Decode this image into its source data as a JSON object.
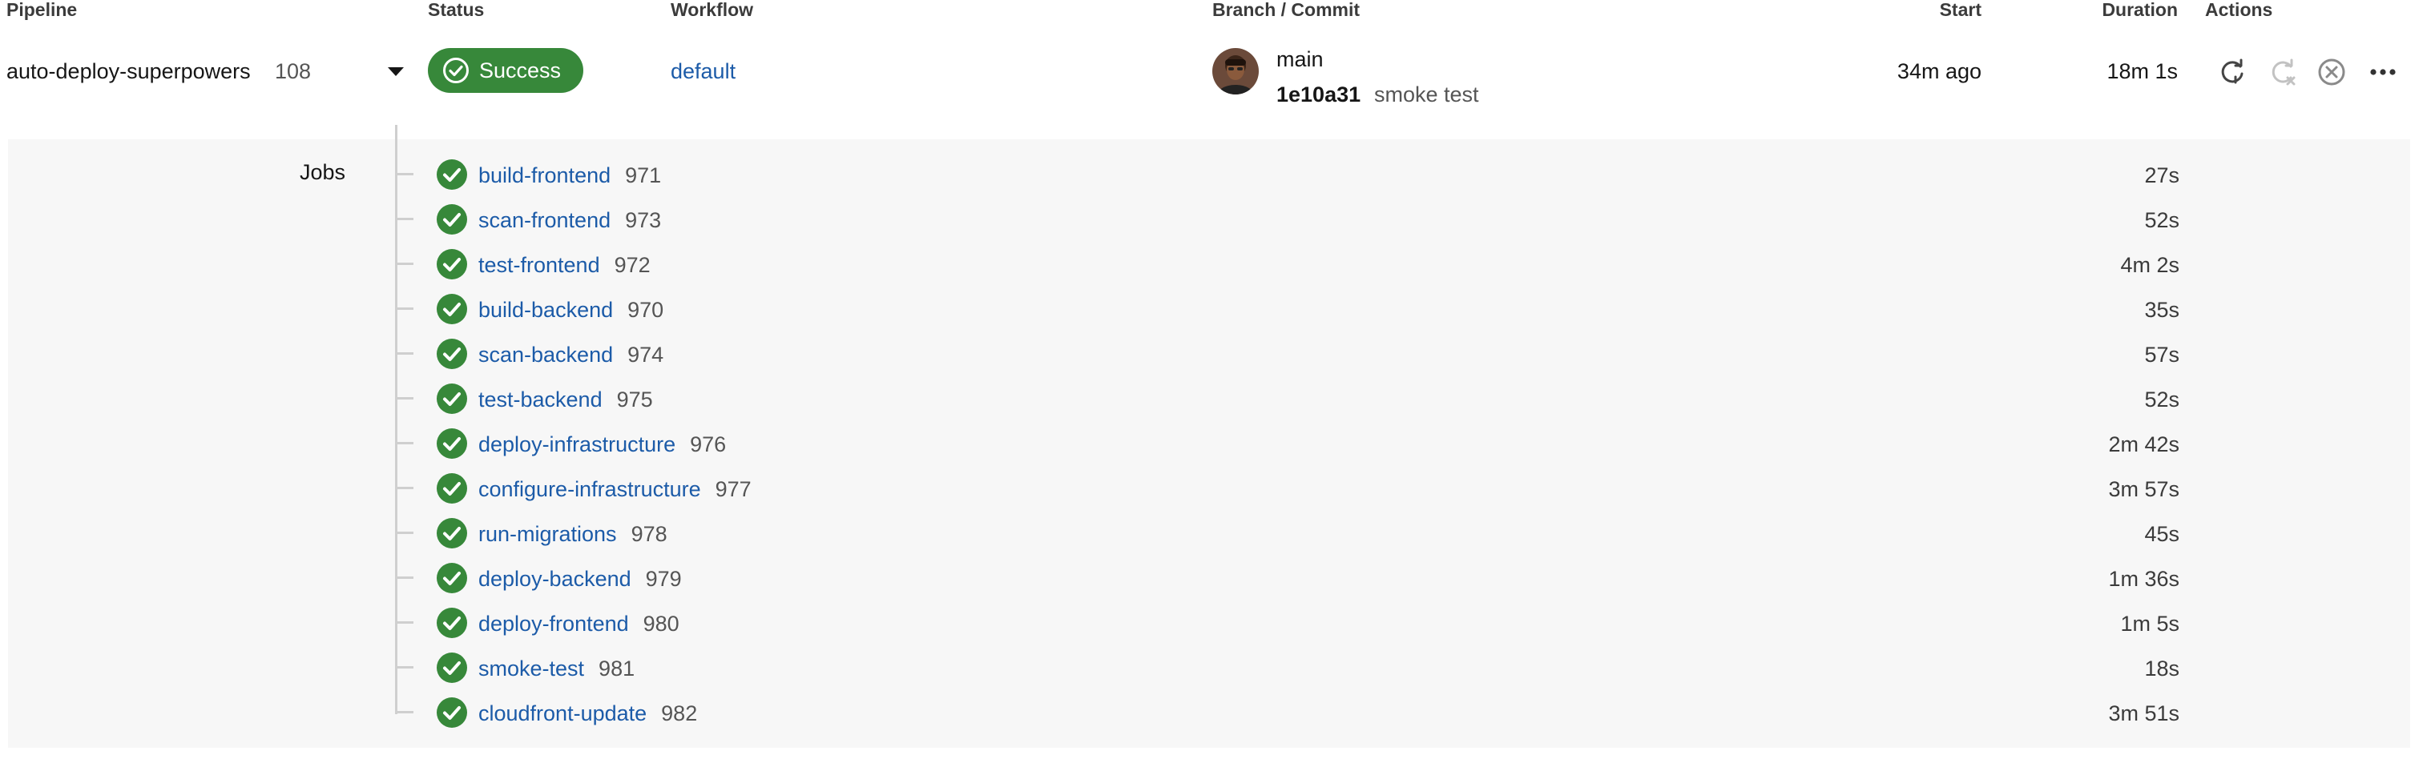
{
  "header": {
    "pipeline": "Pipeline",
    "status": "Status",
    "workflow": "Workflow",
    "branch_commit": "Branch / Commit",
    "start": "Start",
    "duration": "Duration",
    "actions": "Actions"
  },
  "pipeline": {
    "name": "auto-deploy-superpowers",
    "number": "108",
    "status": "Success",
    "workflow": "default",
    "branch": "main",
    "commit_hash": "1e10a31",
    "commit_message": "smoke test",
    "start": "34m ago",
    "duration": "18m 1s"
  },
  "actions": {
    "icons": [
      "rerun-icon",
      "rerun-failed-disabled-icon",
      "cancel-icon",
      "more-icon"
    ]
  },
  "jobs": {
    "label": "Jobs",
    "items": [
      {
        "name": "build-frontend",
        "number": "971",
        "duration": "27s"
      },
      {
        "name": "scan-frontend",
        "number": "973",
        "duration": "52s"
      },
      {
        "name": "test-frontend",
        "number": "972",
        "duration": "4m 2s"
      },
      {
        "name": "build-backend",
        "number": "970",
        "duration": "35s"
      },
      {
        "name": "scan-backend",
        "number": "974",
        "duration": "57s"
      },
      {
        "name": "test-backend",
        "number": "975",
        "duration": "52s"
      },
      {
        "name": "deploy-infrastructure",
        "number": "976",
        "duration": "2m 42s"
      },
      {
        "name": "configure-infrastructure",
        "number": "977",
        "duration": "3m 57s"
      },
      {
        "name": "run-migrations",
        "number": "978",
        "duration": "45s"
      },
      {
        "name": "deploy-backend",
        "number": "979",
        "duration": "1m 36s"
      },
      {
        "name": "deploy-frontend",
        "number": "980",
        "duration": "1m 5s"
      },
      {
        "name": "smoke-test",
        "number": "981",
        "duration": "18s"
      },
      {
        "name": "cloudfront-update",
        "number": "982",
        "duration": "3m 51s"
      }
    ]
  },
  "colors": {
    "success": "#37883a",
    "link": "#1c5ba8",
    "panel": "#f7f7f7"
  }
}
